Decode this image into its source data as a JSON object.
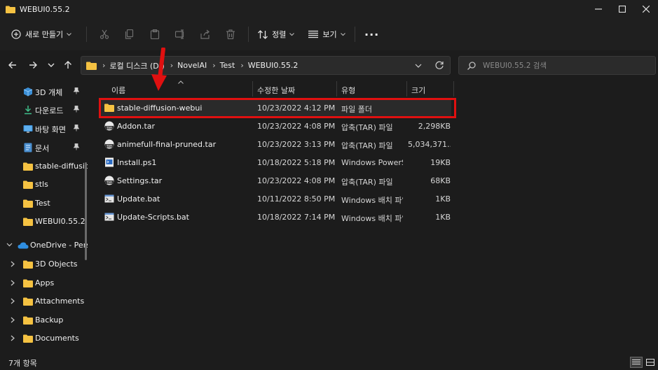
{
  "window": {
    "title": "WEBUI0.55.2"
  },
  "toolbar": {
    "new_label": "새로 만들기",
    "sort_label": "정렬",
    "view_label": "보기",
    "more_label": "···"
  },
  "address": {
    "crumbs": [
      "로컬 디스크 (D:)",
      "NovelAI",
      "Test",
      "WEBUI0.55.2"
    ],
    "search_placeholder": "WEBUI0.55.2 검색"
  },
  "sidebar": {
    "pinned": [
      {
        "label": "3D 개체",
        "icon": "cube-icon"
      },
      {
        "label": "다운로드",
        "icon": "download-icon"
      },
      {
        "label": "바탕 화면",
        "icon": "desktop-icon"
      },
      {
        "label": "문서",
        "icon": "document-icon"
      }
    ],
    "folders": [
      "stable-diffusion",
      "stls",
      "Test",
      "WEBUI0.55.2"
    ],
    "onedrive": {
      "label": "OneDrive - Perso",
      "icon": "cloud-icon"
    },
    "onedrive_children": [
      "3D Objects",
      "Apps",
      "Attachments",
      "Backup",
      "Documents"
    ]
  },
  "columns": {
    "name": "이름",
    "date": "수정한 날짜",
    "type": "유형",
    "size": "크기"
  },
  "files": [
    {
      "name": "stable-diffusion-webui",
      "date": "10/23/2022 4:12 PM",
      "type": "파일 폴더",
      "size": "",
      "icon": "folder-icon"
    },
    {
      "name": "Addon.tar",
      "date": "10/23/2022 4:08 PM",
      "type": "압축(TAR) 파일",
      "size": "2,298KB",
      "icon": "tar-icon"
    },
    {
      "name": "animefull-final-pruned.tar",
      "date": "10/23/2022 3:13 PM",
      "type": "압축(TAR) 파일",
      "size": "5,034,371...",
      "icon": "tar-icon"
    },
    {
      "name": "Install.ps1",
      "date": "10/18/2022 5:18 PM",
      "type": "Windows PowerS...",
      "size": "19KB",
      "icon": "powershell-script-icon"
    },
    {
      "name": "Settings.tar",
      "date": "10/23/2022 4:08 PM",
      "type": "압축(TAR) 파일",
      "size": "68KB",
      "icon": "tar-icon"
    },
    {
      "name": "Update.bat",
      "date": "10/11/2022 8:50 PM",
      "type": "Windows 배치 파일",
      "size": "1KB",
      "icon": "batch-file-icon"
    },
    {
      "name": "Update-Scripts.bat",
      "date": "10/18/2022 7:14 PM",
      "type": "Windows 배치 파일",
      "size": "1KB",
      "icon": "batch-file-icon"
    }
  ],
  "status": {
    "count": "7개 항목"
  },
  "colors": {
    "accent_folder": "#f5c242",
    "highlight": "#e01010",
    "bg": "#1c1c1c"
  }
}
